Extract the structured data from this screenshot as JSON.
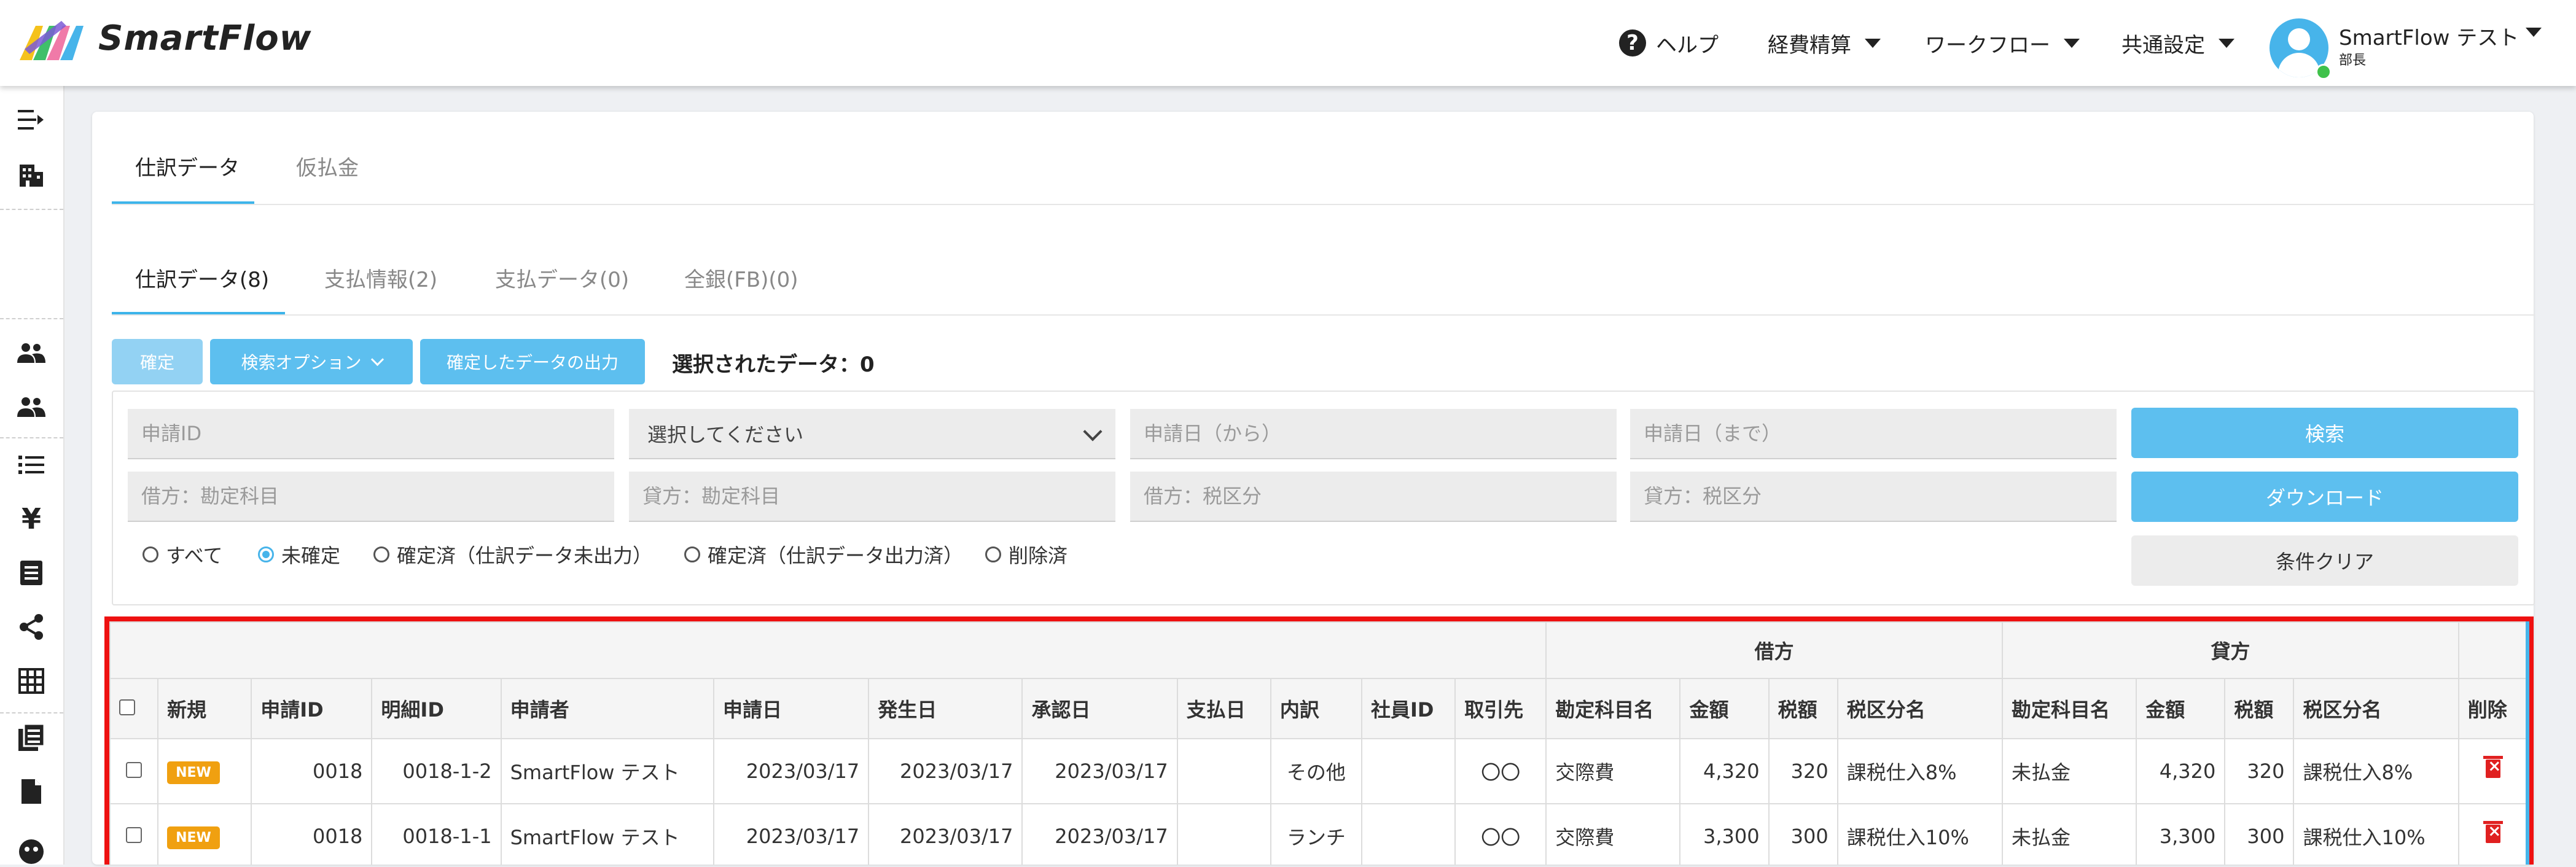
{
  "header": {
    "brand": "SmartFlow",
    "help": "ヘルプ",
    "menu": [
      "経費精算",
      "ワークフロー",
      "共通設定"
    ],
    "user_name": "SmartFlow テスト",
    "user_role": "部長"
  },
  "tabs_top": [
    "仕訳データ",
    "仮払金"
  ],
  "tabs_sub": [
    "仕訳データ(8)",
    "支払情報(2)",
    "支払データ(0)",
    "全銀(FB)(0)"
  ],
  "toolbar": {
    "confirm": "確定",
    "search_options": "検索オプション",
    "export_confirmed": "確定したデータの出力",
    "selected": "選択されたデータ：0"
  },
  "filters": {
    "request_id": "申請ID",
    "select": "選択してください",
    "date_from": "申請日（から）",
    "date_to": "申請日（まで）",
    "debit_account": "借方：勘定科目",
    "credit_account": "貸方：勘定科目",
    "debit_tax": "借方：税区分",
    "credit_tax": "貸方：税区分",
    "search": "検索",
    "download": "ダウンロード",
    "clear": "条件クリア",
    "radios": [
      "すべて",
      "未確定",
      "確定済（仕訳データ未出力）",
      "確定済（仕訳データ出力済）",
      "削除済"
    ]
  },
  "table": {
    "group_debit": "借方",
    "group_credit": "貸方",
    "columns": [
      "新規",
      "申請ID",
      "明細ID",
      "申請者",
      "申請日",
      "発生日",
      "承認日",
      "支払日",
      "内訳",
      "社員ID",
      "取引先",
      "勘定科目名",
      "金額",
      "税額",
      "税区分名",
      "勘定科目名",
      "金額",
      "税額",
      "税区分名",
      "削除"
    ],
    "rows": [
      {
        "badge": "NEW",
        "request_id": "0018",
        "detail_id": "0018-1-2",
        "applicant": "SmartFlow テスト",
        "applied": "2023/03/17",
        "occurred": "2023/03/17",
        "approved": "2023/03/17",
        "paid": "",
        "breakdown": "その他",
        "employee_id": "",
        "partner": "〇〇",
        "debit_account": "交際費",
        "debit_amount": "4,320",
        "debit_tax": "320",
        "debit_tax_class": "課税仕入8%",
        "credit_account": "未払金",
        "credit_amount": "4,320",
        "credit_tax": "320",
        "credit_tax_class": "課税仕入8%"
      },
      {
        "badge": "NEW",
        "request_id": "0018",
        "detail_id": "0018-1-1",
        "applicant": "SmartFlow テスト",
        "applied": "2023/03/17",
        "occurred": "2023/03/17",
        "approved": "2023/03/17",
        "paid": "",
        "breakdown": "ランチ",
        "employee_id": "",
        "partner": "〇〇",
        "debit_account": "交際費",
        "debit_amount": "3,300",
        "debit_tax": "300",
        "debit_tax_class": "課税仕入10%",
        "credit_account": "未払金",
        "credit_amount": "3,300",
        "credit_tax": "300",
        "credit_tax_class": "課税仕入10%"
      }
    ]
  },
  "colors": {
    "accent": "#47b4ea",
    "highlight": "#ee1111",
    "badge": "#f0a010",
    "delete": "#e02020"
  }
}
